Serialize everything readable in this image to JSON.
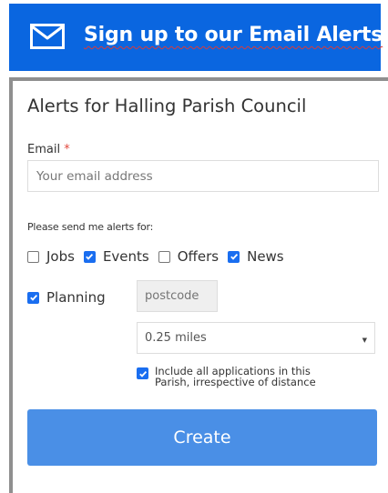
{
  "banner": {
    "title": "Sign up to our Email Alerts",
    "icon": "envelope-icon",
    "background": "#0a66e0"
  },
  "form": {
    "heading": "Alerts for Halling Parish Council",
    "email": {
      "label": "Email",
      "required_mark": "*",
      "placeholder": "Your email address",
      "value": ""
    },
    "alerts_label": "Please send me alerts for:",
    "options": [
      {
        "label": "Jobs",
        "checked": false
      },
      {
        "label": "Events",
        "checked": true
      },
      {
        "label": "Offers",
        "checked": false
      },
      {
        "label": "News",
        "checked": true
      }
    ],
    "planning": {
      "label": "Planning",
      "checked": true,
      "postcode_placeholder": "postcode",
      "distance_selected": "0.25 miles",
      "include_all_label": "Include all applications in this Parish, irrespective of distance",
      "include_all_checked": true
    },
    "create_label": "Create",
    "accent": "#1a6ef0",
    "button_color": "#4a8fe6"
  }
}
